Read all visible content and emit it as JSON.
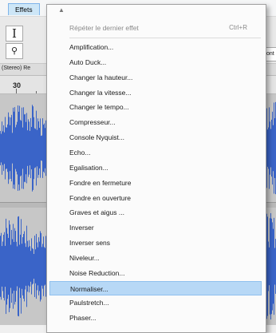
{
  "menubar": {
    "effects_label": "Effets"
  },
  "toolbar": {
    "select_tool_glyph": "I",
    "zoom_tool_glyph": "⚲",
    "right_clipped_text": "ont"
  },
  "track": {
    "label": "(Stereo) Re",
    "ruler_label": "30"
  },
  "menu": {
    "scroll_up_glyph": "▲",
    "repeat_last": {
      "label": "Répéter le dernier effet",
      "shortcut": "Ctrl+R"
    },
    "items": [
      "Amplification...",
      "Auto Duck...",
      "Changer la hauteur...",
      "Changer la vitesse...",
      "Changer le tempo...",
      "Compresseur...",
      "Console Nyquist...",
      "Echo...",
      "Egalisation...",
      "Fondre en fermeture",
      "Fondre en ouverture",
      "Graves et aigus ...",
      "Inverser",
      "Inverser sens",
      "Niveleur...",
      "Noise Reduction...",
      "Normaliser...",
      "Paulstretch...",
      "Phaser..."
    ],
    "selected_item": "Normaliser..."
  },
  "colors": {
    "waveform": "#3a64c8",
    "selection": "#b7d8f6",
    "track_bg": "#c7c7c7"
  }
}
